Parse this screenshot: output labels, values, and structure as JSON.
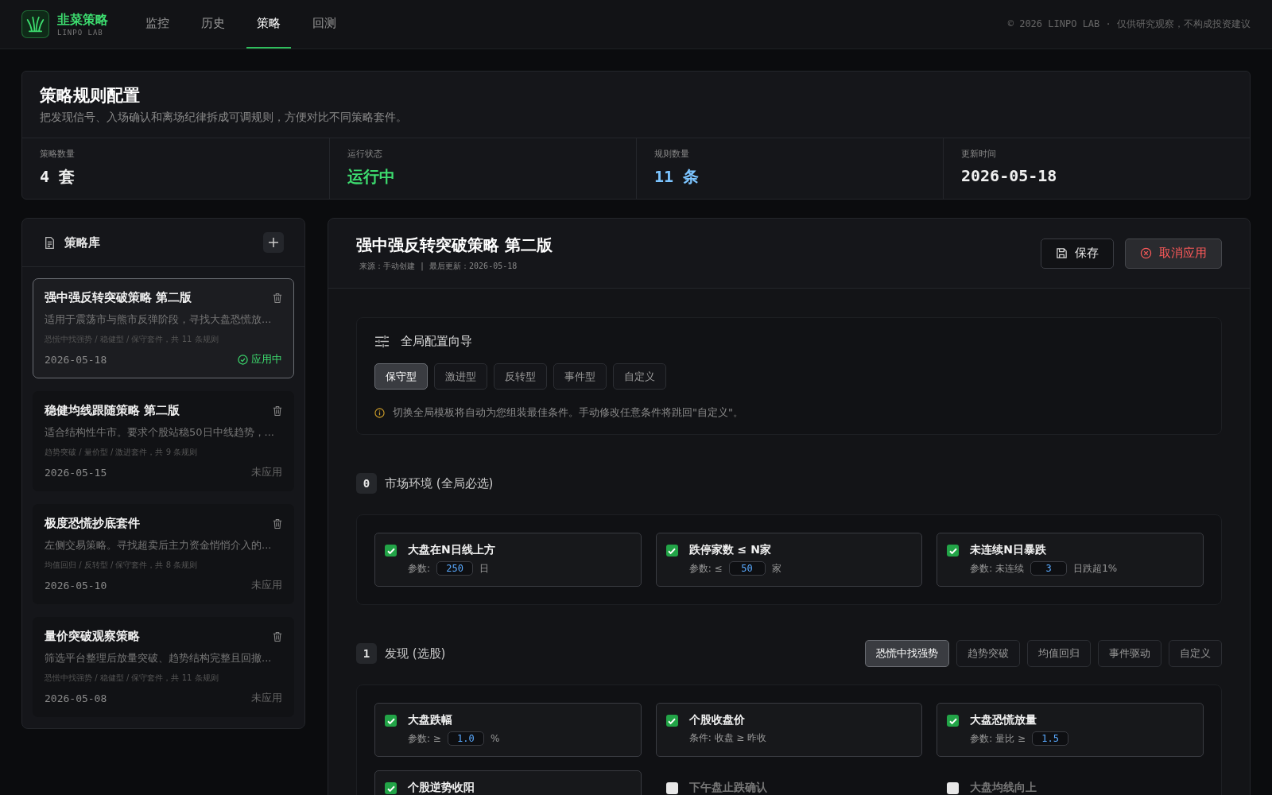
{
  "brand": {
    "name": "韭菜策略",
    "sub": "LINPO LAB"
  },
  "nav": [
    {
      "label": "监控",
      "selected": false
    },
    {
      "label": "历史",
      "selected": false
    },
    {
      "label": "策略",
      "selected": true
    },
    {
      "label": "回测",
      "selected": false
    }
  ],
  "notice": "© 2026 LINPO LAB · 仅供研究观察，不构成投资建议",
  "summary": {
    "title": "策略规则配置",
    "subtitle": "把发现信号、入场确认和离场纪律拆成可调规则，方便对比不同策略套件。",
    "stats": [
      {
        "label": "策略数量",
        "value": "4 套",
        "color": "#f0f0f0"
      },
      {
        "label": "运行状态",
        "value": "运行中",
        "color": "#3ddc6f"
      },
      {
        "label": "规则数量",
        "value": "11 条",
        "color": "#7cc4ff"
      },
      {
        "label": "更新时间",
        "value": "2026-05-18",
        "color": "#f0f0f0"
      }
    ]
  },
  "library": {
    "title": "策略库",
    "items": [
      {
        "name": "强中强反转突破策略 第二版",
        "desc": "适用于震荡市与熊市反弹阶段，寻找大盘恐慌放...",
        "meta": "恐慌中找强势 / 稳健型 / 保守套件，共 11 条规则",
        "date": "2026-05-18",
        "status": "应用中",
        "applied": true,
        "selected": true
      },
      {
        "name": "稳健均线跟随策略 第二版",
        "desc": "适合结构性牛市。要求个股站稳50日中线趋势，...",
        "meta": "趋势突破 / 量价型 / 激进套件，共 9 条规则",
        "date": "2026-05-15",
        "status": "未应用",
        "applied": false,
        "selected": false
      },
      {
        "name": "极度恐慌抄底套件",
        "desc": "左侧交易策略。寻找超卖后主力资金悄悄介入的...",
        "meta": "均值回归 / 反转型 / 保守套件，共 8 条规则",
        "date": "2026-05-10",
        "status": "未应用",
        "applied": false,
        "selected": false
      },
      {
        "name": "量价突破观察策略",
        "desc": "筛选平台整理后放量突破、趋势结构完整且回撤...",
        "meta": "恐慌中找强势 / 稳健型 / 保守套件，共 11 条规则",
        "date": "2026-05-08",
        "status": "未应用",
        "applied": false,
        "selected": false
      }
    ]
  },
  "editor": {
    "title": "强中强反转突破策略 第二版",
    "meta": "来源：手动创建 | 最后更新：2026-05-18",
    "save": "保存",
    "cancel": "取消应用",
    "wizard": {
      "title": "全局配置向导",
      "presets": [
        {
          "label": "保守型",
          "selected": true
        },
        {
          "label": "激进型",
          "selected": false
        },
        {
          "label": "反转型",
          "selected": false
        },
        {
          "label": "事件型",
          "selected": false
        },
        {
          "label": "自定义",
          "selected": false
        }
      ],
      "hint": "切换全局模板将自动为您组装最佳条件。手动修改任意条件将跳回\"自定义\"。"
    },
    "sections": [
      {
        "index": "0",
        "title": "市场环境 (全局必选)",
        "rules": [
          {
            "name": "大盘在N日线上方",
            "checked": true,
            "param": [
              {
                "kind": "text",
                "text": "参数:"
              },
              {
                "kind": "value",
                "text": "250"
              },
              {
                "kind": "text",
                "text": "日"
              }
            ]
          },
          {
            "name": "跌停家数 ≤ N家",
            "checked": true,
            "param": [
              {
                "kind": "text",
                "text": "参数: ≤"
              },
              {
                "kind": "value",
                "text": "50"
              },
              {
                "kind": "text",
                "text": "家"
              }
            ]
          },
          {
            "name": "未连续N日暴跌",
            "checked": true,
            "param": [
              {
                "kind": "text",
                "text": "参数: 未连续"
              },
              {
                "kind": "value",
                "text": "3"
              },
              {
                "kind": "text",
                "text": "日跌超1%"
              }
            ]
          }
        ]
      },
      {
        "index": "1",
        "title": "发现 (选股)",
        "presets": [
          {
            "label": "恐慌中找强势",
            "selected": true
          },
          {
            "label": "趋势突破",
            "selected": false
          },
          {
            "label": "均值回归",
            "selected": false
          },
          {
            "label": "事件驱动",
            "selected": false
          },
          {
            "label": "自定义",
            "selected": false
          }
        ],
        "rules": [
          {
            "name": "大盘跌幅",
            "checked": true,
            "param": [
              {
                "kind": "text",
                "text": "参数: ≥"
              },
              {
                "kind": "value",
                "text": "1.0"
              },
              {
                "kind": "text",
                "text": "%"
              }
            ]
          },
          {
            "name": "个股收盘价",
            "checked": true,
            "param": [
              {
                "kind": "text",
                "text": "条件: 收盘 ≥ 昨收"
              }
            ]
          },
          {
            "name": "大盘恐慌放量",
            "checked": true,
            "param": [
              {
                "kind": "text",
                "text": "参数: 量比 ≥"
              },
              {
                "kind": "value",
                "text": "1.5"
              }
            ]
          },
          {
            "name": "个股逆势收阳",
            "checked": true
          },
          {
            "name": "下午盘止跌确认",
            "checked": false
          },
          {
            "name": "大盘均线向上",
            "checked": false
          }
        ]
      }
    ]
  }
}
